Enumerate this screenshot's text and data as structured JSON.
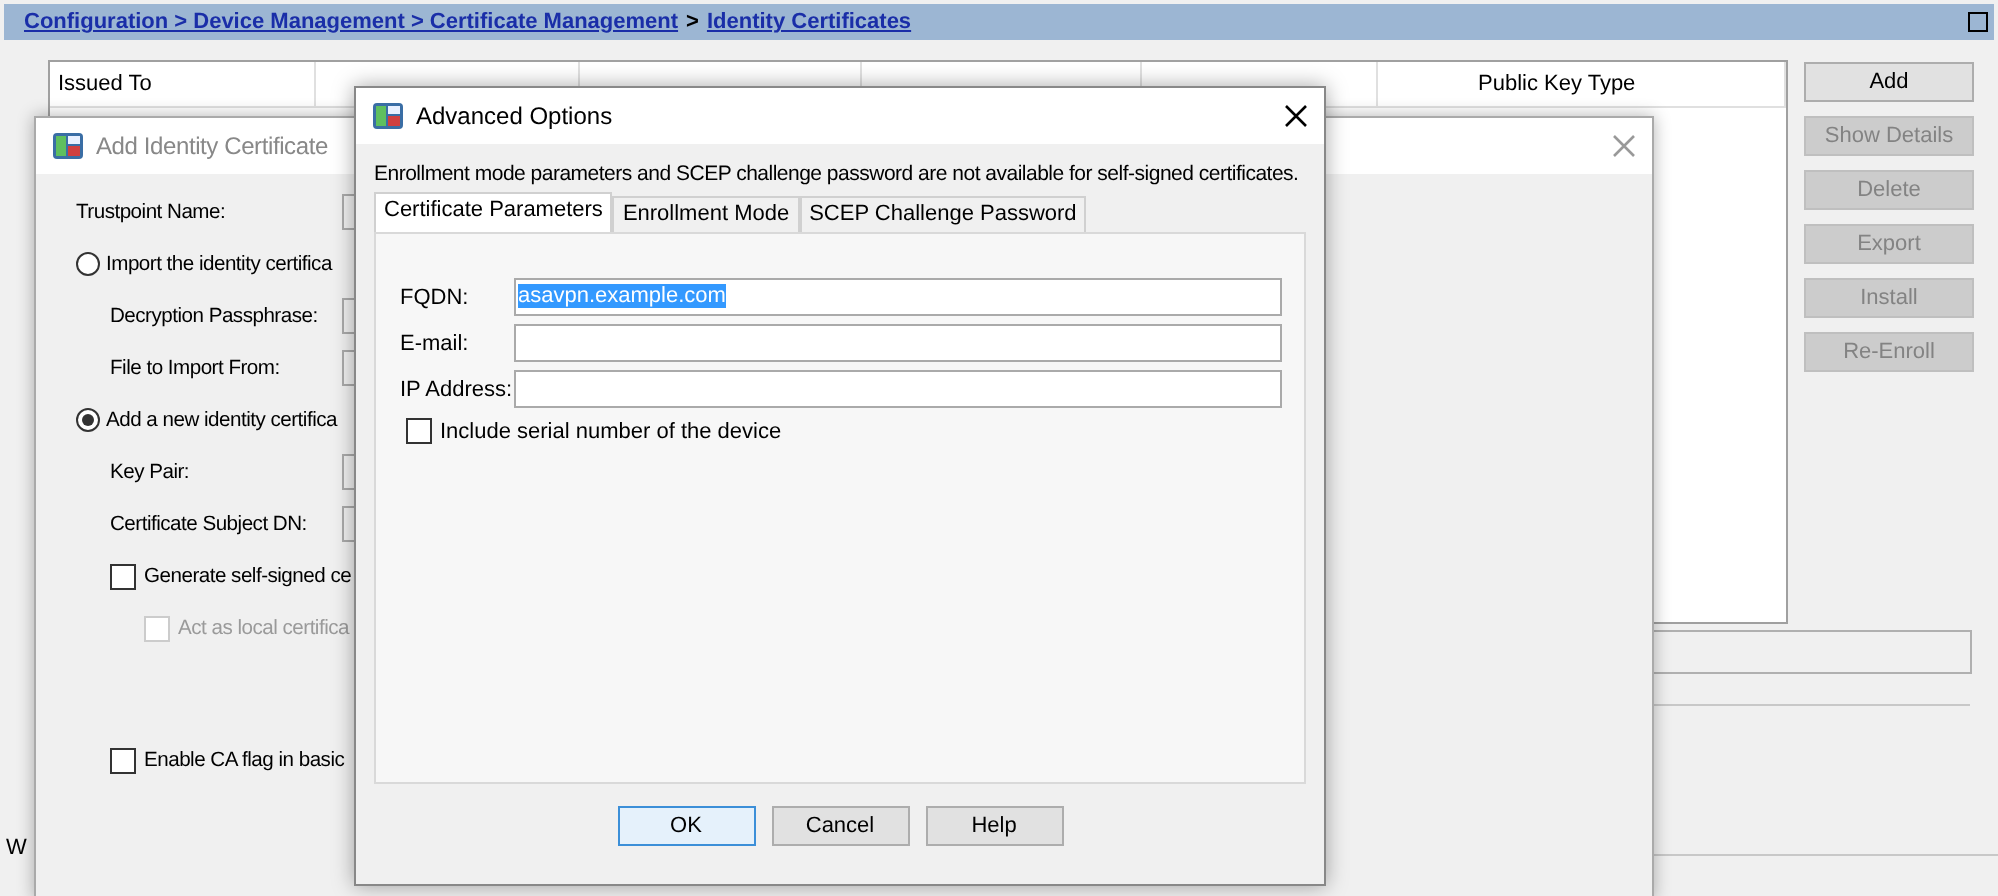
{
  "breadcrumb": {
    "links": [
      "Configuration > Device Management > Certificate Management",
      "Identity Certificates"
    ],
    "separator": ">"
  },
  "table": {
    "columns": [
      {
        "label": "Issued To"
      },
      {
        "label": "Public Key Type"
      }
    ]
  },
  "buttons": [
    {
      "label": "Add",
      "disabled": false
    },
    {
      "label": "Show Details",
      "disabled": true
    },
    {
      "label": "Delete",
      "disabled": true
    },
    {
      "label": "Export",
      "disabled": true
    },
    {
      "label": "Install",
      "disabled": true
    },
    {
      "label": "Re-Enroll",
      "disabled": true
    }
  ],
  "background_text": "W",
  "add_dialog": {
    "title": "Add Identity Certificate",
    "active": false,
    "items": [
      {
        "kind": "field",
        "label": "Trustpoint Name:"
      },
      {
        "kind": "radio",
        "label": "Import the identity certifica",
        "selected": false,
        "children": [
          {
            "kind": "field",
            "label": "Decryption Passphrase:"
          },
          {
            "kind": "field",
            "label": "File to Import From:"
          }
        ]
      },
      {
        "kind": "radio",
        "label": "Add a new identity certifica",
        "selected": true,
        "children": [
          {
            "kind": "field",
            "label": "Key Pair:"
          },
          {
            "kind": "field",
            "label": "Certificate Subject DN:"
          },
          {
            "kind": "checkbox",
            "label": "Generate self-signed ce",
            "checked": false,
            "disabled": false,
            "children": [
              {
                "kind": "checkbox",
                "label": "Act as local certifica",
                "checked": false,
                "disabled": true
              }
            ]
          },
          {
            "kind": "checkbox",
            "label": "Enable CA flag in basic",
            "checked": false,
            "disabled": false
          }
        ]
      }
    ]
  },
  "advanced_dialog": {
    "title": "Advanced Options",
    "active": true,
    "note": "Enrollment mode parameters and SCEP challenge password are not available for self-signed certificates.",
    "tabs": [
      {
        "label": "Certificate Parameters",
        "selected": true
      },
      {
        "label": "Enrollment Mode",
        "selected": false
      },
      {
        "label": "SCEP Challenge Password",
        "selected": false
      }
    ],
    "fields": [
      {
        "label": "FQDN:",
        "value": "asavpn.example.com",
        "text_selected": true
      },
      {
        "label": "E-mail:"
      },
      {
        "label": "IP Address:"
      }
    ],
    "checkbox": {
      "label": "Include serial number of the device",
      "checked": false
    },
    "buttons": [
      {
        "label": "OK",
        "default": true
      },
      {
        "label": "Cancel",
        "default": false
      },
      {
        "label": "Help",
        "default": false
      }
    ]
  }
}
